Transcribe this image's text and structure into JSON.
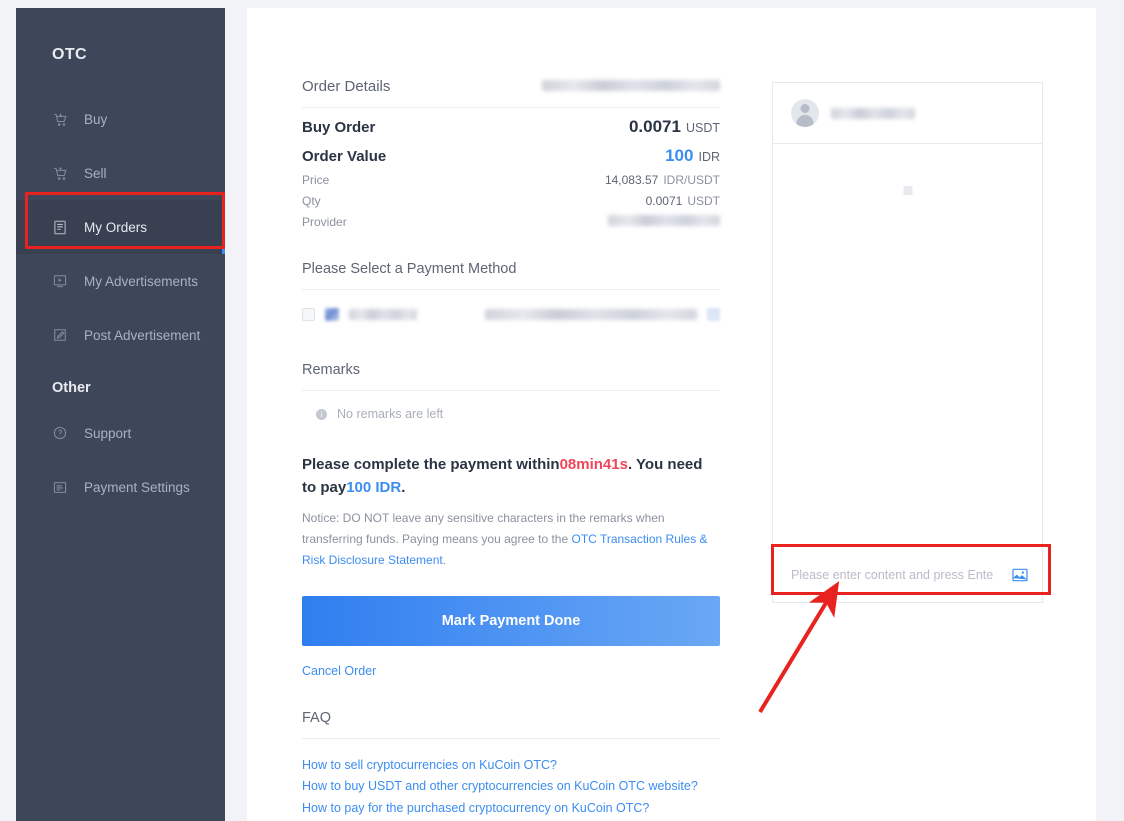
{
  "sidebar": {
    "brand": "OTC",
    "items": [
      {
        "label": "Buy",
        "icon": "cart-down-icon",
        "active": false
      },
      {
        "label": "Sell",
        "icon": "cart-up-icon",
        "active": false
      },
      {
        "label": "My Orders",
        "icon": "orders-list-icon",
        "active": true
      },
      {
        "label": "My Advertisements",
        "icon": "advertisement-icon",
        "active": false
      },
      {
        "label": "Post Advertisement",
        "icon": "edit-square-icon",
        "active": false
      }
    ],
    "section_other": "Other",
    "other_items": [
      {
        "label": "Support",
        "icon": "question-circle-icon"
      },
      {
        "label": "Payment Settings",
        "icon": "payment-card-icon"
      }
    ]
  },
  "order": {
    "details_title": "Order Details",
    "details_id_masked": "",
    "buy_order_label": "Buy Order",
    "buy_order_value": "0.0071",
    "buy_order_unit": "USDT",
    "order_value_label": "Order Value",
    "order_value_amount": "100",
    "order_value_unit": "IDR",
    "price_label": "Price",
    "price_value": "14,083.57",
    "price_unit": "IDR/USDT",
    "qty_label": "Qty",
    "qty_value": "0.0071",
    "qty_unit": "USDT",
    "provider_label": "Provider",
    "provider_value_masked": ""
  },
  "payment": {
    "select_title": "Please Select a Payment Method",
    "method_name_masked": "",
    "method_detail_masked": ""
  },
  "remarks": {
    "title": "Remarks",
    "empty_text": "No remarks are left"
  },
  "notice": {
    "line_prefix": "Please complete the payment within",
    "countdown": "08min41s",
    "line_middle": ". You need to pay",
    "amount": "100 IDR",
    "line_suffix": ".",
    "small_prefix": "Notice: DO NOT leave any sensitive characters in the remarks when transferring funds. Paying means you agree to the ",
    "link_text": "OTC Transaction Rules & Risk Disclosure Statement",
    "small_suffix": "."
  },
  "actions": {
    "primary_label": "Mark Payment Done",
    "cancel_label": "Cancel Order"
  },
  "faq": {
    "title": "FAQ",
    "items": [
      "How to sell cryptocurrencies on KuCoin OTC?",
      "How to buy USDT and other cryptocurrencies on KuCoin OTC website?",
      "How to pay for the purchased cryptocurrency on KuCoin OTC?"
    ]
  },
  "chat": {
    "counterparty_name_masked": "",
    "input_placeholder": "Please enter content and press Ente",
    "image_button_icon": "image-upload-icon"
  },
  "colors": {
    "accent_blue": "#3c8df0",
    "danger_red": "#f0465a",
    "annotation_red": "#e8231f",
    "sidebar_bg": "#3e4759",
    "page_bg": "#f2f3f7"
  }
}
